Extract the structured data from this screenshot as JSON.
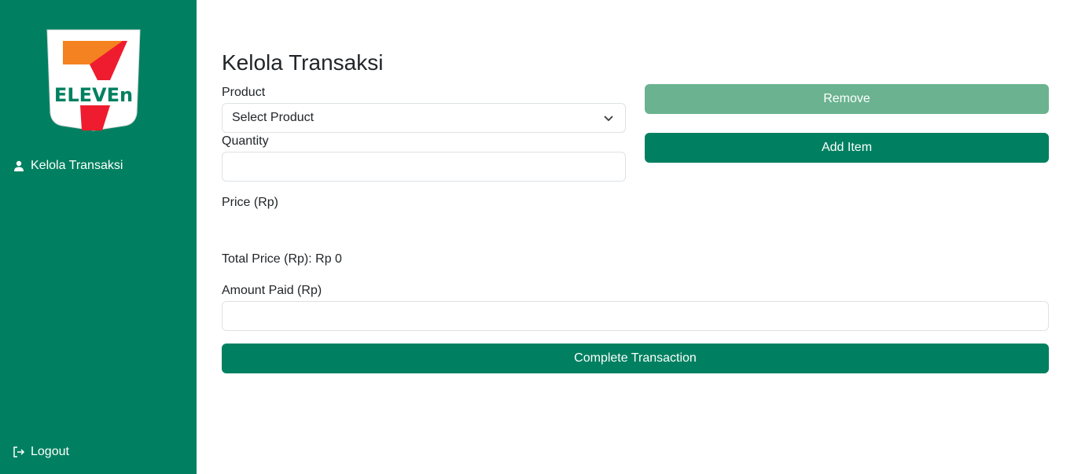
{
  "sidebar": {
    "logo": {
      "name": "7-eleven-logo",
      "text": "ELEVEN",
      "colors": {
        "orange": "#f58220",
        "red": "#ee1c2e",
        "green": "#008060"
      }
    },
    "items": [
      {
        "label": "Kelola Transaksi",
        "icon": "user-icon"
      }
    ],
    "logout": {
      "label": "Logout",
      "icon": "logout-icon"
    }
  },
  "main": {
    "title": "Kelola Transaksi",
    "product_label": "Product",
    "product_select": "Select Product",
    "quantity_label": "Quantity",
    "quantity_value": "",
    "price_label": "Price (Rp)",
    "total_price": "Total Price (Rp): Rp 0",
    "amount_paid_label": "Amount Paid (Rp)",
    "amount_paid_value": "",
    "remove_label": "Remove",
    "add_item_label": "Add Item",
    "complete_label": "Complete Transaction"
  },
  "colors": {
    "sidebar": "#008060",
    "primary": "#008060",
    "disabled": "#6bb390"
  }
}
